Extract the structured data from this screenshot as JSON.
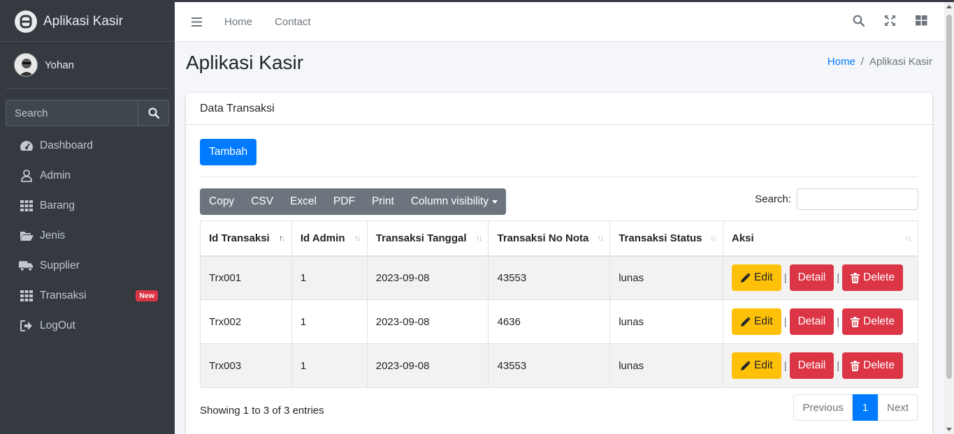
{
  "sidebar": {
    "brand": "Aplikasi Kasir",
    "user_name": "Yohan",
    "search_placeholder": "Search",
    "items": [
      {
        "label": "Dashboard",
        "icon": "tachometer-icon"
      },
      {
        "label": "Admin",
        "icon": "user-icon"
      },
      {
        "label": "Barang",
        "icon": "grid-icon"
      },
      {
        "label": "Jenis",
        "icon": "folder-open-icon"
      },
      {
        "label": "Supplier",
        "icon": "truck-icon"
      },
      {
        "label": "Transaksi",
        "icon": "grid-icon",
        "badge": "New"
      },
      {
        "label": "LogOut",
        "icon": "sign-out-icon"
      }
    ]
  },
  "topnav": {
    "links": [
      "Home",
      "Contact"
    ]
  },
  "header": {
    "title": "Aplikasi Kasir",
    "breadcrumb_home": "Home",
    "breadcrumb_sep": "/",
    "breadcrumb_current": "Aplikasi Kasir"
  },
  "card": {
    "title": "Data Transaksi",
    "add_button": "Tambah",
    "export_buttons": [
      "Copy",
      "CSV",
      "Excel",
      "PDF",
      "Print",
      "Column visibility"
    ],
    "search_label": "Search:",
    "columns": [
      "Id Transaksi",
      "Id Admin",
      "Transaksi Tanggal",
      "Transaksi No Nota",
      "Transaksi Status",
      "Aksi"
    ],
    "rows": [
      [
        "Trx001",
        "1",
        "2023-09-08",
        "43553",
        "lunas"
      ],
      [
        "Trx002",
        "1",
        "2023-09-08",
        "4636",
        "lunas"
      ],
      [
        "Trx003",
        "1",
        "2023-09-08",
        "43553",
        "lunas"
      ]
    ],
    "actions": {
      "edit": "Edit",
      "detail": "Detail",
      "delete": "Delete",
      "separator": "|"
    },
    "info": "Showing 1 to 3 of 3 entries",
    "pagination": {
      "previous": "Previous",
      "current": "1",
      "next": "Next"
    }
  },
  "colors": {
    "sidebar_bg": "#343a40",
    "primary": "#007bff",
    "warning": "#ffc107",
    "danger": "#dc3545",
    "secondary": "#6c757d"
  }
}
